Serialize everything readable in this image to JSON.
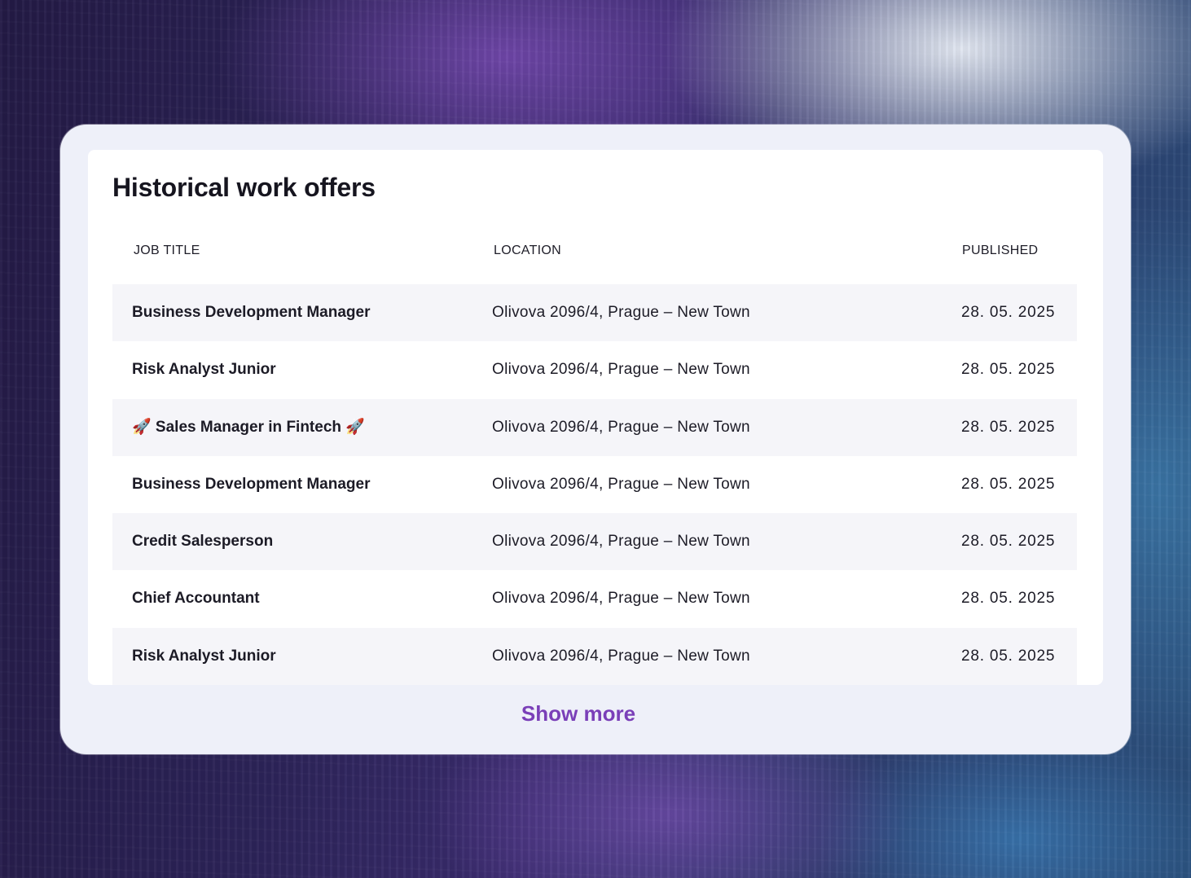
{
  "card": {
    "title": "Historical work offers",
    "columns": {
      "job": "JOB TITLE",
      "location": "LOCATION",
      "published": "PUBLISHED"
    },
    "rows": [
      {
        "job": "Business Development Manager",
        "location": "Olivova 2096/4, Prague – New Town",
        "published": "28. 05. 2025"
      },
      {
        "job": "Risk Analyst Junior",
        "location": "Olivova 2096/4, Prague – New Town",
        "published": "28. 05. 2025"
      },
      {
        "job": "🚀 Sales Manager in Fintech 🚀",
        "location": "Olivova 2096/4, Prague – New Town",
        "published": "28. 05. 2025"
      },
      {
        "job": "Business Development Manager",
        "location": "Olivova 2096/4, Prague – New Town",
        "published": "28. 05. 2025"
      },
      {
        "job": "Credit Salesperson",
        "location": "Olivova 2096/4, Prague – New Town",
        "published": "28. 05. 2025"
      },
      {
        "job": "Chief Accountant",
        "location": "Olivova 2096/4, Prague – New Town",
        "published": "28. 05. 2025"
      },
      {
        "job": "Risk Analyst Junior",
        "location": "Olivova 2096/4, Prague – New Town",
        "published": "28. 05. 2025"
      }
    ],
    "show_more_label": "Show more"
  },
  "colors": {
    "accent": "#7a3fb8",
    "row_alt": "#f5f5f9",
    "card_bg": "#eef0f9"
  }
}
